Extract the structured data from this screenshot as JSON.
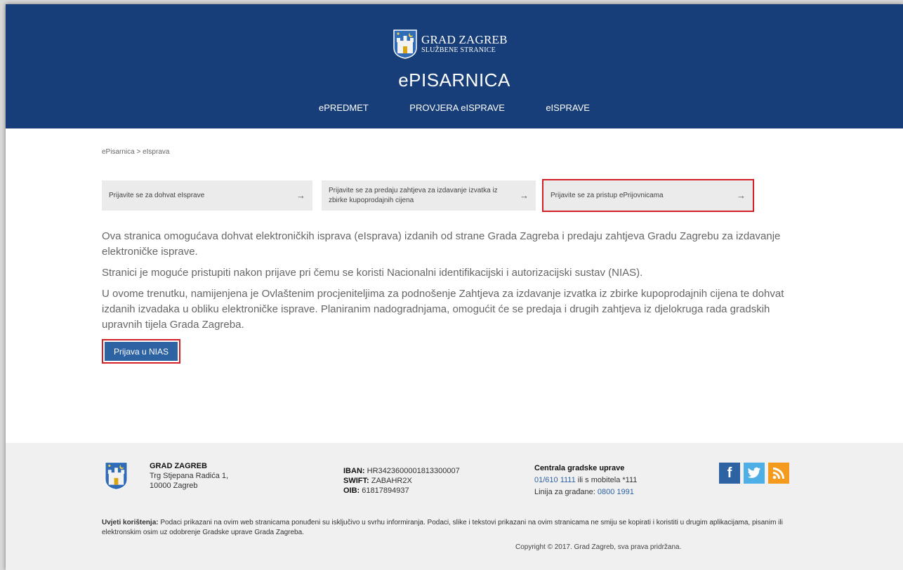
{
  "header": {
    "logo_title": "GRAD ZAGREB",
    "logo_subtitle": "SLUŽBENE STRANICE",
    "site_title": "ePISARNICA",
    "nav": [
      "ePREDMET",
      "PROVJERA eISPRAVE",
      "eISPRAVE"
    ]
  },
  "breadcrumb": "ePisarnica > eIsprava",
  "cards": [
    {
      "label": "Prijavite se za dohvat eIsprave",
      "arrow": "→"
    },
    {
      "label": "Prijavite se za predaju zahtjeva za izdavanje izvatka iz zbirke kupoprodajnih cijena",
      "arrow": "→"
    },
    {
      "label": "Prijavite se za pristup ePrijovnicama",
      "arrow": "→"
    }
  ],
  "content": {
    "p1": "Ova stranica omogućava dohvat elektroničkih isprava (eIsprava) izdanih od strane Grada Zagreba i predaju zahtjeva Gradu Zagrebu za izdavanje elektroničke isprave.",
    "p2": "Stranici je moguće pristupiti nakon prijave pri čemu se koristi Nacionalni identifikacijski i autorizacijski sustav (NIAS).",
    "p3": "U ovome trenutku, namijenjena je Ovlaštenim procjeniteljima za podnošenje Zahtjeva za izdavanje izvatka iz zbirke kupoprodajnih cijena te dohvat izdanih izvadaka u obliku elektroničke isprave. Planiranim nadogradnjama, omogućit će se predaja i drugih zahtjeva iz djelokruga rada gradskih upravnih tijela Grada Zagreba.",
    "button": "Prijava u NIAS"
  },
  "footer": {
    "org_name": "GRAD ZAGREB",
    "address1": "Trg Stjepana Radića 1,",
    "address2": "10000 Zagreb",
    "iban_label": "IBAN:",
    "iban": "HR3423600001813300007",
    "swift_label": "SWIFT:",
    "swift": "ZABAHR2X",
    "oib_label": "OIB:",
    "oib": "61817894937",
    "central_title": "Centrala gradske uprave",
    "phone": "01/610 1111",
    "phone_suffix": " ili s mobitela *111",
    "hotline_label": "Linija za građane: ",
    "hotline": "0800 1991",
    "terms_label": "Uvjeti korištenja:",
    "terms_text": " Podaci prikazani na ovim web stranicama ponuđeni su isključivo u svrhu informiranja. Podaci, slike i tekstovi prikazani na ovim stranicama ne smiju se kopirati i koristiti u drugim aplikacijama, pisanim ili elektronskim osim uz odobrenje Gradske uprave Grada Zagreba.",
    "copyright": "Copyright © 2017. Grad Zagreb, sva prava pridržana.",
    "social": [
      "facebook-icon",
      "twitter-icon",
      "rss-icon"
    ]
  },
  "colors": {
    "header_bg": "#173e78",
    "button": "#2d62a3",
    "highlight": "#d32027"
  }
}
